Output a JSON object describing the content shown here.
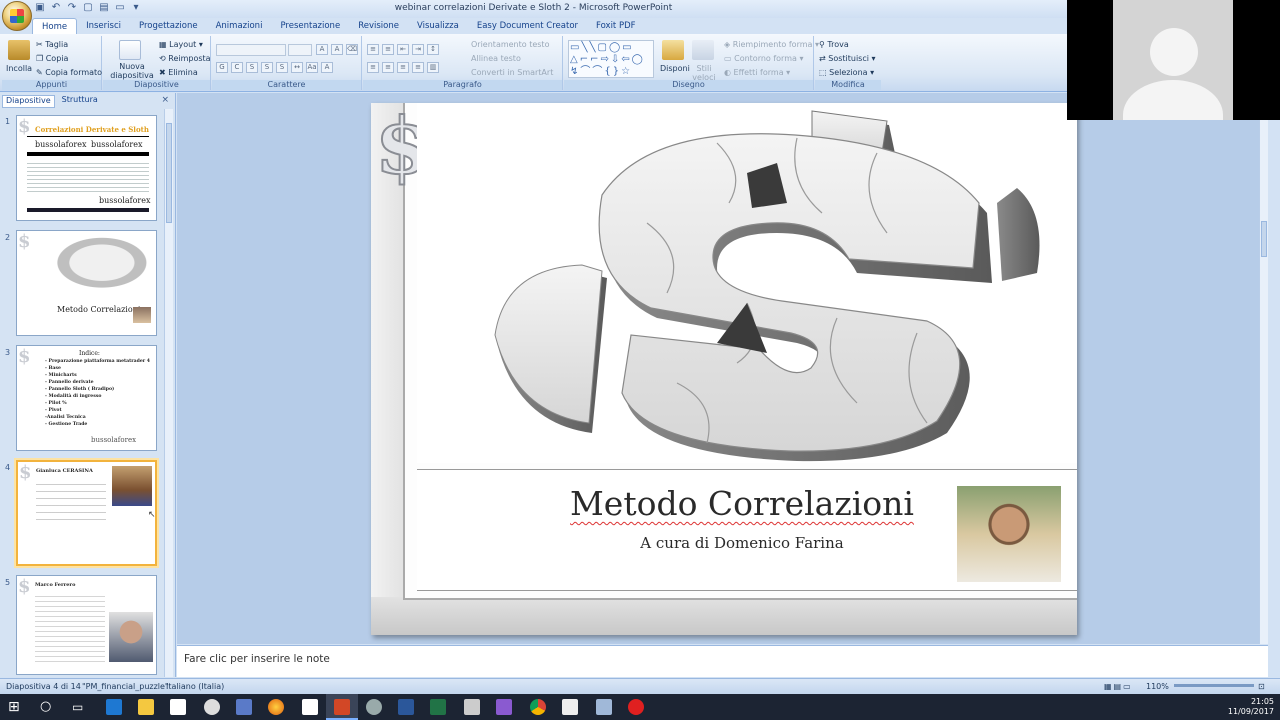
{
  "window": {
    "title": "webinar correlazioni Derivate e Sloth 2 - Microsoft PowerPoint"
  },
  "ribbon": {
    "tabs": [
      "Home",
      "Inserisci",
      "Progettazione",
      "Animazioni",
      "Presentazione",
      "Revisione",
      "Visualizza",
      "Easy Document Creator",
      "Foxit PDF"
    ],
    "clipboard": {
      "paste": "Incolla",
      "cut": "Taglia",
      "copy": "Copia",
      "format_painter": "Copia formato",
      "label": "Appunti"
    },
    "slides": {
      "new_slide": "Nuova diapositiva",
      "layout": "Layout",
      "reset": "Reimposta",
      "delete": "Elimina",
      "label": "Diapositive"
    },
    "font": {
      "label": "Carattere"
    },
    "paragraph": {
      "text_direction": "Orientamento testo",
      "align_text": "Allinea testo",
      "convert_smartart": "Converti in SmartArt",
      "label": "Paragrafo"
    },
    "drawing": {
      "arrange": "Disponi",
      "quick_styles": "Stili veloci",
      "shape_fill": "Riempimento forma",
      "shape_outline": "Contorno forma",
      "shape_effects": "Effetti forma",
      "label": "Disegno"
    },
    "editing": {
      "find": "Trova",
      "replace": "Sostituisci",
      "select": "Seleziona",
      "label": "Modifica"
    }
  },
  "panel": {
    "tabs": [
      "Diapositive",
      "Struttura"
    ],
    "thumbnails": [
      {
        "num": "1",
        "title": "Correlazioni Derivate e Sloth",
        "brand_a": "bussolaforex",
        "brand_b": "bussolaforex",
        "brand_c": "bussolaforex"
      },
      {
        "num": "2",
        "title": "Metodo Correlazioni"
      },
      {
        "num": "3",
        "heading": "Indice:",
        "items": [
          "- Preparazione piattaforma metatrader 4",
          "- Base",
          "- Minicharts",
          "- Pannello derivate",
          "- Pannello Sloth ( Bradipo)",
          "- Modalità di ingresso",
          "- Pilot %",
          "- Pivot",
          "-Analisi Tecnica",
          "- Gestione Trade"
        ],
        "brand": "bussolaforex"
      },
      {
        "num": "4",
        "heading": "Gianluca CERASINA"
      },
      {
        "num": "5",
        "heading": "Marco Ferrero"
      }
    ]
  },
  "slide": {
    "title": "Metodo Correlazioni",
    "subtitle": "A cura di Domenico Farina"
  },
  "notes": {
    "placeholder": "Fare clic per inserire le note"
  },
  "status": {
    "slide_counter": "Diapositiva 4 di 14",
    "theme": "\"PM_financial_puzzle\"",
    "language": "Italiano (Italia)",
    "zoom": "110%"
  },
  "taskbar": {
    "time": "21:05",
    "date": "11/09/2017"
  },
  "colors": {
    "ribbon_blue": "#d3e2f4",
    "accent": "#f2b33d"
  }
}
